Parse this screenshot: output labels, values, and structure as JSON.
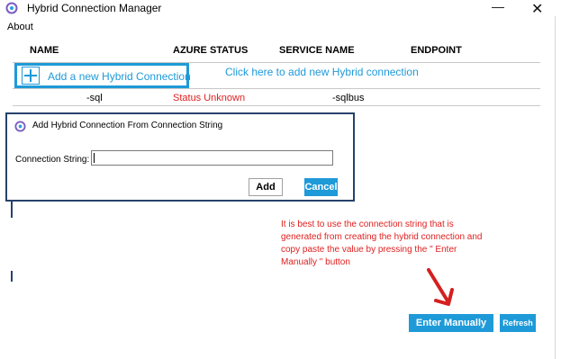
{
  "window": {
    "title": "Hybrid Connection Manager",
    "minimize_glyph": "—",
    "close_glyph": "✕"
  },
  "menu": {
    "about": "About"
  },
  "table": {
    "headers": [
      "NAME",
      "AZURE STATUS",
      "SERVICE NAME",
      "ENDPOINT"
    ],
    "add_connection_label": "Add a new Hybrid Connection",
    "add_hint": "Click here to add new Hybrid connection",
    "rows": [
      {
        "name": "-sql",
        "status": "Status Unknown",
        "service": "-sqlbus"
      }
    ]
  },
  "dialog": {
    "title": "Add Hybrid Connection From Connection String",
    "field_label": "Connection String:",
    "field_value": "",
    "add_label": "Add",
    "cancel_label": "Cancel"
  },
  "annotation": {
    "note": "It is best to use the connection string that is generated from creating the hybrid connection and copy paste the value by pressing the \" Enter Manually \" button"
  },
  "footer": {
    "enter_manually_label": "Enter Manually",
    "refresh_label": "Refresh"
  },
  "colors": {
    "accent": "#1e9ad8",
    "status_red": "#e02020",
    "dialog_border": "#27426b"
  },
  "icons": {
    "app": "hybrid-connection-logo-icon",
    "add": "plus-icon",
    "arrow": "arrow-down-right-icon"
  }
}
